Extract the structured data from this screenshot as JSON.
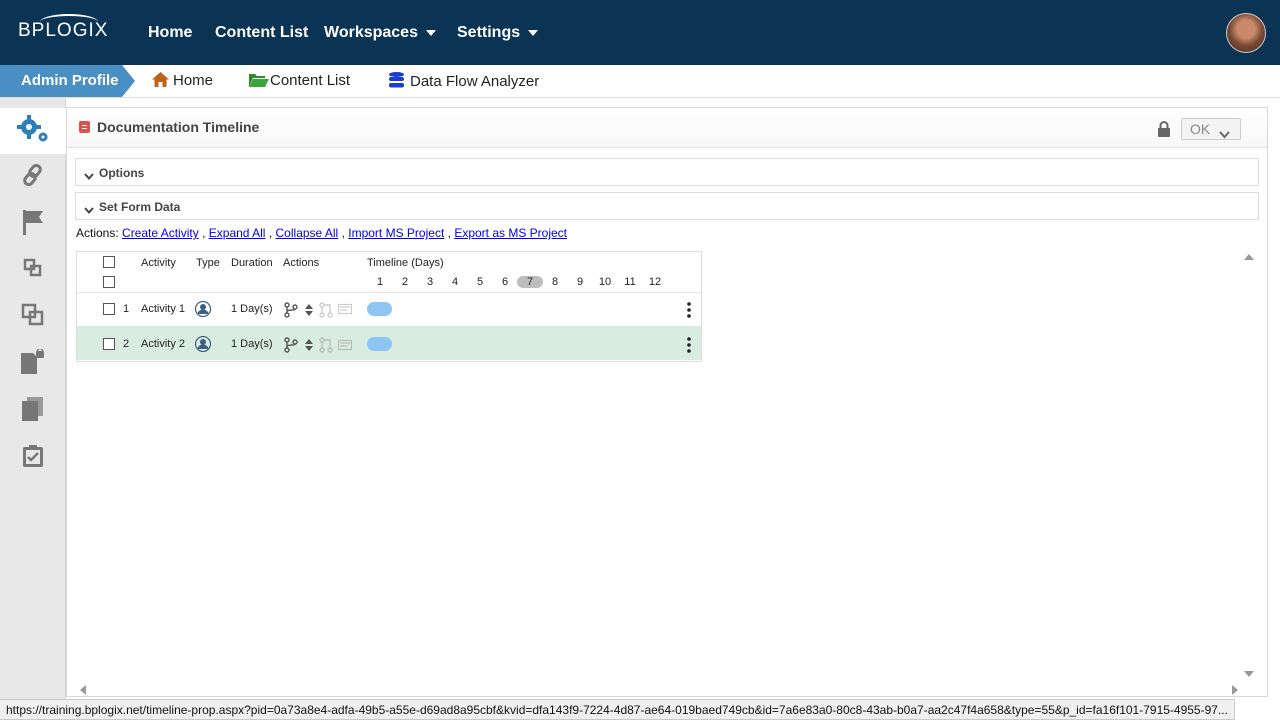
{
  "topnav": {
    "logo": "BPLOGIX",
    "items": [
      {
        "label": "Home"
      },
      {
        "label": "Content List"
      },
      {
        "label": "Workspaces"
      },
      {
        "label": "Settings"
      }
    ]
  },
  "breadcrumb": {
    "profile": "Admin Profile",
    "home": "Home",
    "content_list": "Content List",
    "data_flow": "Data Flow Analyzer"
  },
  "document": {
    "title": "Documentation Timeline",
    "ok_label": "OK"
  },
  "sections": {
    "options": "Options",
    "set_form_data": "Set Form Data"
  },
  "actions": {
    "prefix": "Actions:",
    "create": "Create Activity",
    "expand": "Expand All",
    "collapse": "Collapse All",
    "import": "Import MS Project",
    "export": "Export as MS Project",
    "sep": ","
  },
  "grid": {
    "headers": {
      "activity": "Activity",
      "type": "Type",
      "duration": "Duration",
      "actions": "Actions",
      "timeline": "Timeline (Days)"
    },
    "days": [
      "1",
      "2",
      "3",
      "4",
      "5",
      "6",
      "7",
      "8",
      "9",
      "10",
      "11",
      "12"
    ],
    "today_index": 6,
    "rows": [
      {
        "num": "1",
        "activity": "Activity 1",
        "duration": "1 Day(s)",
        "selected": false
      },
      {
        "num": "2",
        "activity": "Activity 2",
        "duration": "1 Day(s)",
        "selected": true
      }
    ]
  },
  "status_url": "https://training.bplogix.net/timeline-prop.aspx?pid=0a73a8e4-adfa-49b5-a55e-d69ad8a95cbf&kvid=dfa143f9-7224-4d87-ae64-019baed749cb&id=7a6e83a0-80c8-43ab-b0a7-aa2c47f4a658&type=55&p_id=fa16f101-7915-4955-97...",
  "colors": {
    "nav_bg": "#0b3354",
    "profile_bg": "#4a8fc4",
    "selected_row": "#d8ede0",
    "timeline_bar": "#8ec5f2"
  }
}
